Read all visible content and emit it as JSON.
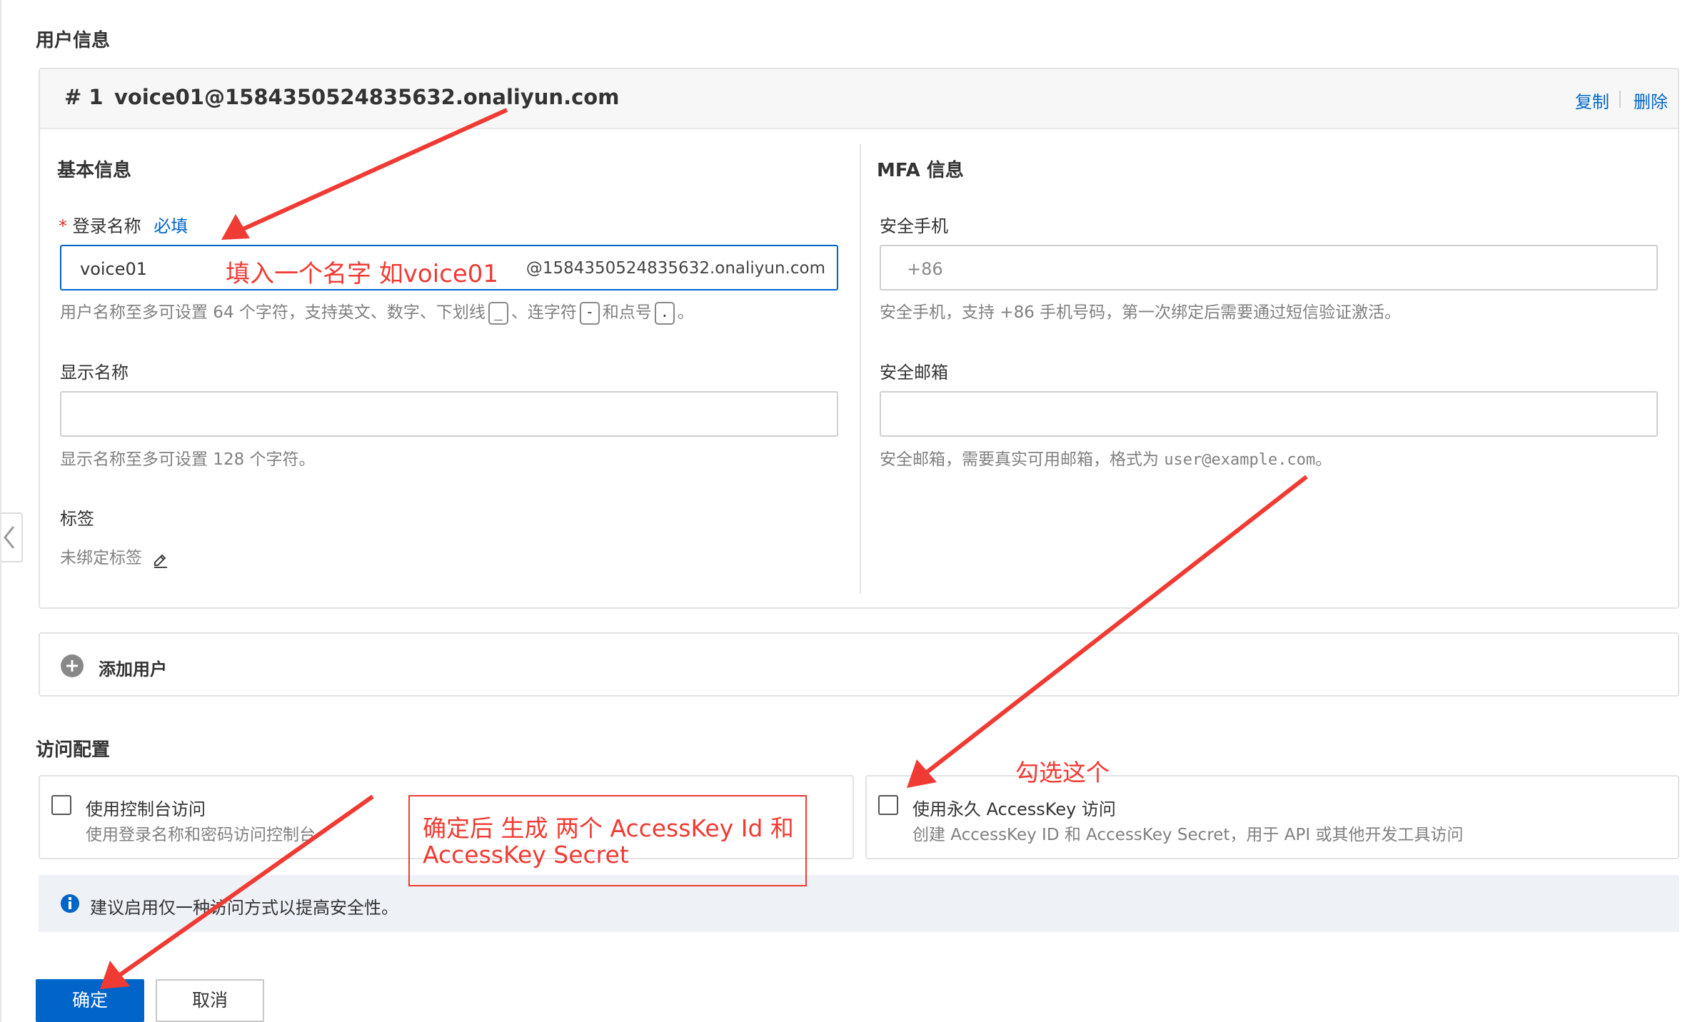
{
  "user_info": {
    "title": "用户信息",
    "entry": {
      "number": "# 1",
      "email": "voice01@1584350524835632.onaliyun.com",
      "copy_label": "复制",
      "delete_label": "删除"
    },
    "basic": {
      "title": "基本信息",
      "login_name_label": "登录名称",
      "required_star": "*",
      "required_tag": "必填",
      "login_name_value": "voice01",
      "login_name_suffix": "@1584350524835632.onaliyun.com",
      "login_help_1": "用户名称至多可设置 64 个字符，支持英文、数字、下划线",
      "kbd_underscore": "_",
      "login_help_2": "、连字符",
      "kbd_dash": "-",
      "login_help_3": "和点号",
      "kbd_dot": ".",
      "login_help_4": "。",
      "display_name_label": "显示名称",
      "display_name_value": "",
      "display_help": "显示名称至多可设置 128 个字符。",
      "tags_label": "标签",
      "tags_value": "未绑定标签"
    },
    "mfa": {
      "title": "MFA 信息",
      "phone_label": "安全手机",
      "phone_placeholder": "+86",
      "phone_help": "安全手机，支持 +86 手机号码，第一次绑定后需要通过短信验证激活。",
      "email_label": "安全邮箱",
      "email_value": "",
      "email_help_1": "安全邮箱，需要真实可用邮箱，格式为 ",
      "email_help_code": "user@example.com",
      "email_help_2": "。"
    },
    "add_user_label": "添加用户"
  },
  "access": {
    "title": "访问配置",
    "console": {
      "label": "使用控制台访问",
      "desc": "使用登录名称和密码访问控制台",
      "checked": false
    },
    "accesskey": {
      "label": "使用永久 AccessKey 访问",
      "desc": "创建 AccessKey ID 和 AccessKey Secret，用于 API 或其他开发工具访问",
      "checked": false
    },
    "notice": "建议启用仅一种访问方式以提高安全性。"
  },
  "buttons": {
    "ok": "确定",
    "cancel": "取消"
  },
  "annotations": {
    "name_hint": "填入一个名字 如voice01",
    "check_hint": "勾选这个",
    "result_hint_1": "确定后 生成 两个 AccessKey Id 和",
    "result_hint_2": "AccessKey Secret",
    "color": "#ef3b34"
  },
  "colors": {
    "primary": "#0064c8",
    "required": "#d93026",
    "notice_bg": "#eef1f6"
  }
}
